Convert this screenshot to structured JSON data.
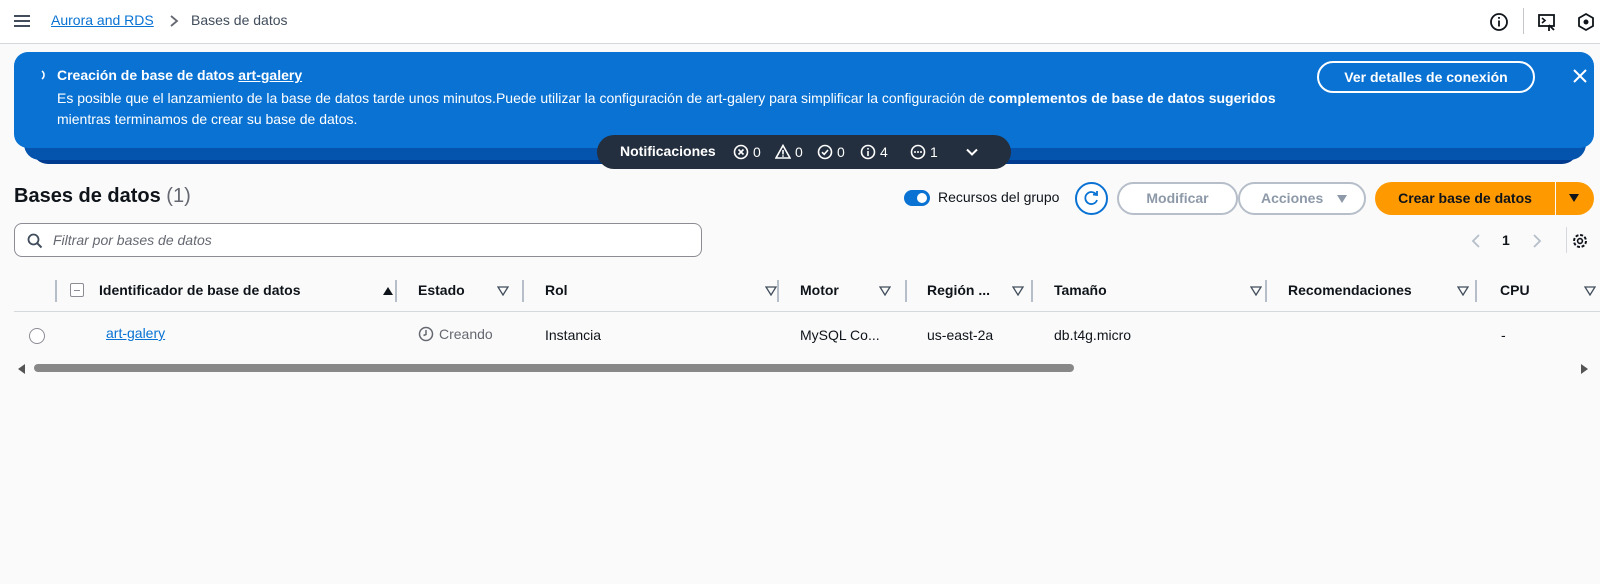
{
  "breadcrumb": {
    "parent": "Aurora and RDS",
    "current": "Bases de datos"
  },
  "flash": {
    "title_prefix": "Creación de base de datos",
    "title_link": "art-galery",
    "body_part1": "Es posible que el lanzamiento de la base de datos tarde unos minutos.Puede utilizar la configuración de art-galery para simplificar la configuración de",
    "body_bold": "complementos de base de datos sugeridos",
    "body_part2": "mientras terminamos de crear su base de datos.",
    "button": "Ver detalles de conexión",
    "color": "#0972d3"
  },
  "notifications": {
    "label": "Notificaciones",
    "errors": "0",
    "warnings": "0",
    "success": "0",
    "info": "4",
    "in_progress": "1"
  },
  "section": {
    "title": "Bases de datos",
    "count": "(1)",
    "toggle_label": "Recursos del grupo",
    "modify": "Modificar",
    "actions": "Acciones",
    "create": "Crear base de datos",
    "create_color": "#ff9900"
  },
  "filter": {
    "placeholder": "Filtrar por bases de datos",
    "value": ""
  },
  "pagination": {
    "page": "1"
  },
  "table": {
    "columns": [
      "Identificador de base de datos",
      "Estado",
      "Rol",
      "Motor",
      "Región ...",
      "Tamaño",
      "Recomendaciones",
      "CPU"
    ],
    "rows": [
      {
        "identifier": "art-galery",
        "status": "Creando",
        "role": "Instancia",
        "engine": "MySQL Co...",
        "region": "us-east-2a",
        "size": "db.t4g.micro",
        "recommendations": "",
        "cpu": "-"
      }
    ]
  }
}
